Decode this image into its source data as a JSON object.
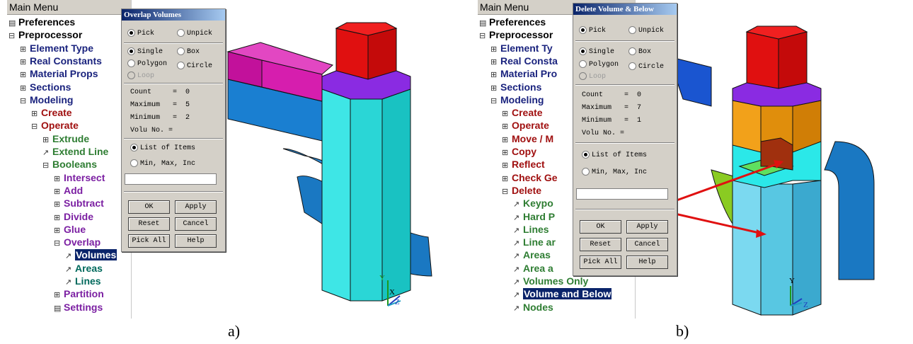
{
  "panel_a": {
    "menu": {
      "title": "Main Menu",
      "items": [
        {
          "sym": "▤",
          "label": "Preferences",
          "color": "#000000"
        },
        {
          "sym": "⊟",
          "label": "Preprocessor",
          "color": "#000000"
        },
        {
          "sym": "⊞",
          "label": "Element Type",
          "color": "#1a237e"
        },
        {
          "sym": "⊞",
          "label": "Real Constants",
          "color": "#1a237e"
        },
        {
          "sym": "⊞",
          "label": "Material Props",
          "color": "#1a237e"
        },
        {
          "sym": "⊞",
          "label": "Sections",
          "color": "#1a237e"
        },
        {
          "sym": "⊟",
          "label": "Modeling",
          "color": "#1a237e"
        },
        {
          "sym": "⊞",
          "label": "Create",
          "color": "#a01010"
        },
        {
          "sym": "⊟",
          "label": "Operate",
          "color": "#a01010"
        },
        {
          "sym": "⊞",
          "label": "Extrude",
          "color": "#2e7d32"
        },
        {
          "sym": "↗",
          "label": "Extend Line",
          "color": "#2e7d32"
        },
        {
          "sym": "⊟",
          "label": "Booleans",
          "color": "#2e7d32"
        },
        {
          "sym": "⊞",
          "label": "Intersect",
          "color": "#7b1fa2"
        },
        {
          "sym": "⊞",
          "label": "Add",
          "color": "#7b1fa2"
        },
        {
          "sym": "⊞",
          "label": "Subtract",
          "color": "#7b1fa2"
        },
        {
          "sym": "⊞",
          "label": "Divide",
          "color": "#7b1fa2"
        },
        {
          "sym": "⊞",
          "label": "Glue",
          "color": "#7b1fa2"
        },
        {
          "sym": "⊟",
          "label": "Overlap",
          "color": "#7b1fa2"
        },
        {
          "sym": "↗",
          "label": "Volumes",
          "color": "#ffffff",
          "selected": true
        },
        {
          "sym": "↗",
          "label": "Areas",
          "color": "#00695c"
        },
        {
          "sym": "↗",
          "label": "Lines",
          "color": "#00695c"
        },
        {
          "sym": "⊞",
          "label": "Partition",
          "color": "#7b1fa2"
        },
        {
          "sym": "▤",
          "label": "Settings",
          "color": "#7b1fa2"
        }
      ]
    },
    "dialog": {
      "title": "Overlap Volumes",
      "pick": "Pick",
      "unpick": "Unpick",
      "single": "Single",
      "box": "Box",
      "polygon": "Polygon",
      "circle": "Circle",
      "loop": "Loop",
      "count": "Count     =  0",
      "maximum": "Maximum   =  5",
      "minimum": "Minimum   =  2",
      "volu": "Volu No. =",
      "list": "List of Items",
      "minmax": "Min, Max, Inc",
      "ok": "OK",
      "apply": "Apply",
      "reset": "Reset",
      "cancel": "Cancel",
      "pickall": "Pick All",
      "help": "Help"
    },
    "caption": "a)",
    "axes": {
      "y": "Y",
      "x": "X",
      "z": "Z"
    }
  },
  "panel_b": {
    "menu": {
      "title": "Main Menu",
      "items": [
        {
          "sym": "▤",
          "label": "Preferences",
          "color": "#000000"
        },
        {
          "sym": "⊟",
          "label": "Preprocessor",
          "color": "#000000"
        },
        {
          "sym": "⊞",
          "label": "Element Ty",
          "color": "#1a237e"
        },
        {
          "sym": "⊞",
          "label": "Real Consta",
          "color": "#1a237e"
        },
        {
          "sym": "⊞",
          "label": "Material Pro",
          "color": "#1a237e"
        },
        {
          "sym": "⊞",
          "label": "Sections",
          "color": "#1a237e"
        },
        {
          "sym": "⊟",
          "label": "Modeling",
          "color": "#1a237e"
        },
        {
          "sym": "⊞",
          "label": "Create",
          "color": "#a01010"
        },
        {
          "sym": "⊞",
          "label": "Operate",
          "color": "#a01010"
        },
        {
          "sym": "⊞",
          "label": "Move / M",
          "color": "#a01010"
        },
        {
          "sym": "⊞",
          "label": "Copy",
          "color": "#a01010"
        },
        {
          "sym": "⊞",
          "label": "Reflect",
          "color": "#a01010"
        },
        {
          "sym": "⊞",
          "label": "Check Ge",
          "color": "#a01010"
        },
        {
          "sym": "⊟",
          "label": "Delete",
          "color": "#a01010"
        },
        {
          "sym": "↗",
          "label": "Keypo",
          "color": "#2e7d32"
        },
        {
          "sym": "↗",
          "label": "Hard P",
          "color": "#2e7d32"
        },
        {
          "sym": "↗",
          "label": "Lines ",
          "color": "#2e7d32"
        },
        {
          "sym": "↗",
          "label": "Line ar",
          "color": "#2e7d32"
        },
        {
          "sym": "↗",
          "label": "Areas",
          "color": "#2e7d32"
        },
        {
          "sym": "↗",
          "label": "Area a",
          "color": "#2e7d32"
        },
        {
          "sym": "↗",
          "label": "Volumes Only",
          "color": "#2e7d32"
        },
        {
          "sym": "↗",
          "label": "Volume and Below",
          "color": "#ffffff",
          "selected": true
        },
        {
          "sym": "↗",
          "label": "Nodes",
          "color": "#2e7d32"
        }
      ]
    },
    "dialog": {
      "title": "Delete Volume & Below",
      "pick": "Pick",
      "unpick": "Unpick",
      "single": "Single",
      "box": "Box",
      "polygon": "Polygon",
      "circle": "Circle",
      "loop": "Loop",
      "count": "Count     =  0",
      "maximum": "Maximum   =  7",
      "minimum": "Minimum   =  1",
      "volu": "Volu No. =",
      "list": "List of Items",
      "minmax": "Min, Max, Inc",
      "ok": "OK",
      "apply": "Apply",
      "reset": "Reset",
      "cancel": "Cancel",
      "pickall": "Pick All",
      "help": "Help"
    },
    "caption": "b)",
    "axes": {
      "y": "Y",
      "z": "Z"
    }
  }
}
